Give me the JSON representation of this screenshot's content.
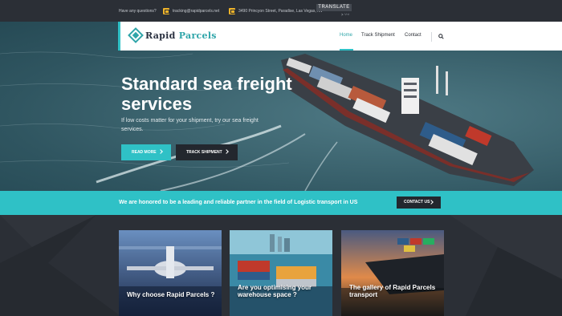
{
  "topbar": {
    "question": "Have any questions?",
    "email": "tracking@rapidparcels.net",
    "address": "3490 Princyon Street, Paradise, Las Vegas, NV",
    "translate": "TRANSLATE",
    "translate_sub": "⮞ Vrd"
  },
  "logo": {
    "part1": "Rapid",
    "part2": "Parcels"
  },
  "nav": {
    "home": "Home",
    "track": "Track Shipment",
    "contact": "Contact"
  },
  "hero": {
    "title": "Standard sea freight services",
    "subtitle": "If low costs matter for your shipment, try our sea freight services.",
    "read_more": "READ MORE",
    "track": "TRACK SHIPMENT"
  },
  "banner": {
    "text": "We are honored to be a leading and reliable partner in the field of Logistic transport in US",
    "contact": "CONTACT US"
  },
  "cards": [
    {
      "title": "Why choose Rapid Parcels ?"
    },
    {
      "title": "Are you optimising your warehouse space ?"
    },
    {
      "title": "The gallery of Rapid Parcels transport"
    }
  ],
  "colors": {
    "accent": "#2fc1c6",
    "dark": "#23272e",
    "icon_yellow": "#f0b429"
  }
}
